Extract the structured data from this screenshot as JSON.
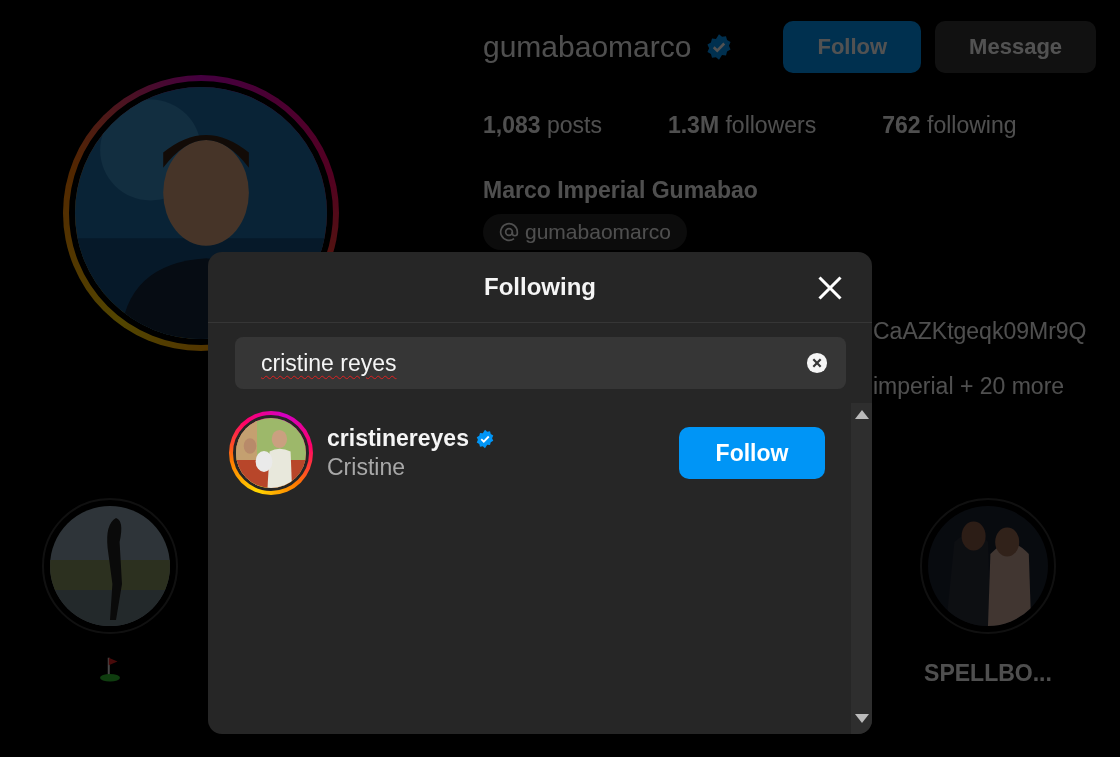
{
  "profile": {
    "username": "gumabaomarco",
    "verified": true,
    "buttons": [
      {
        "label": "Follow",
        "kind": "primary"
      },
      {
        "label": "Message",
        "kind": "secondary"
      }
    ],
    "stats": [
      {
        "value": "1,083",
        "label": "posts"
      },
      {
        "value": "1.3M",
        "label": "followers"
      },
      {
        "value": "762",
        "label": "following"
      }
    ],
    "full_name": "Marco Imperial Gumabao",
    "threads_handle": "gumabaomarco",
    "bio_lines": [
      "CaAZKtgeqk09Mr9Q",
      "imperial + 20 more"
    ]
  },
  "highlights": [
    {
      "kind": "picture"
    },
    {
      "kind": "picture",
      "label": "SPELLBO..."
    }
  ],
  "dialog": {
    "title": "Following",
    "search": {
      "value": "cristine reyes"
    },
    "results": [
      {
        "username": "cristinereyes",
        "verified": true,
        "name": "Cristine",
        "story_ring": true,
        "button": "Follow"
      }
    ]
  }
}
